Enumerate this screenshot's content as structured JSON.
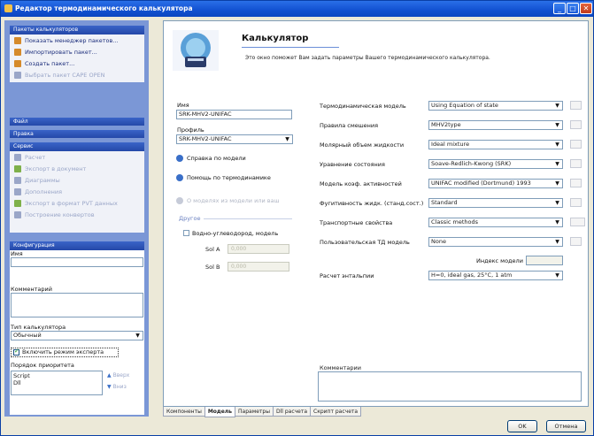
{
  "window": {
    "title": "Редактор термодинамического калькулятора"
  },
  "left": {
    "packages": {
      "header": "Пакеты калькуляторов",
      "items": [
        {
          "label": "Показать менеджер пакетов...",
          "icon": "package-manager-icon",
          "enabled": true
        },
        {
          "label": "Импортировать пакет...",
          "icon": "import-package-icon",
          "enabled": true
        },
        {
          "label": "Создать пакет...",
          "icon": "create-package-icon",
          "enabled": true
        },
        {
          "label": "Выбрать пакет CAPE OPEN",
          "icon": "cape-open-icon",
          "enabled": false
        }
      ]
    },
    "file_bar": "Файл",
    "edit_bar": "Правка",
    "service": {
      "header": "Сервис",
      "items": [
        {
          "label": "Расчет",
          "icon": "calculate-icon"
        },
        {
          "label": "Экспорт в документ",
          "icon": "export-document-icon"
        },
        {
          "label": "Диаграммы",
          "icon": "diagrams-icon"
        },
        {
          "label": "Дополнения",
          "icon": "addons-icon"
        },
        {
          "label": "Экспорт в формат PVT данных",
          "icon": "export-pvt-icon"
        },
        {
          "label": "Построение конвертов",
          "icon": "envelope-icon"
        }
      ]
    },
    "config": {
      "header": "Конфигурация",
      "name_label": "Имя",
      "name_value": "",
      "comment_label": "Комментарий",
      "comment_value": "",
      "calc_type_label": "Тип калькулятора",
      "calc_type_value": "Обычный",
      "expert_mode_label": "Включить режим эксперта",
      "priority_label": "Порядок приоритета",
      "priority_items": [
        "Script",
        "Dll"
      ],
      "up_label": "Вверх",
      "down_label": "Вниз"
    }
  },
  "main": {
    "title": "Калькулятор",
    "description": "Это окно поможет Вам задать параметры Вашего термодинамического калькулятора.",
    "name_label": "Имя",
    "name_value": "SRK-MHV2-UNIFAC",
    "profile_label": "Профиль",
    "profile_value": "SRK-MHV2-UNIFAC",
    "help_model": "Справка по модели",
    "help_thermo": "Помощь по термодинамике",
    "based_on_link": "О моделях из модели или ваш",
    "other_label": "Другое",
    "water_hc_label": "Водно-углеводород, модель",
    "sol_a_label": "Sol A",
    "sol_a_value": "0,000",
    "sol_b_label": "Sol B",
    "sol_b_value": "0,000",
    "properties": [
      {
        "label": "Термодинамическая модель",
        "value": "Using Equation of state"
      },
      {
        "label": "Правила смешения",
        "value": "MHV2type"
      },
      {
        "label": "Молярный объем жидкости",
        "value": "Ideal mixture"
      },
      {
        "label": "Уравнение состояния",
        "value": "Soave-Redlich-Kwong (SRK)"
      },
      {
        "label": "Модель коэф. активностей",
        "value": "UNIFAC modified (Dortmund) 1993"
      },
      {
        "label": "Фугитивность жидк. (станд.сост.)",
        "value": "Standard"
      },
      {
        "label": "Транспортные свойства",
        "value": "Classic methods"
      },
      {
        "label": "Пользовательская ТД модель",
        "value": "None"
      }
    ],
    "model_index_label": "Индекс модели",
    "model_index_value": "",
    "enthalpy_label": "Расчет энтальпии",
    "enthalpy_value": "H=0, ideal gas, 25°C, 1 atm",
    "comments_label": "Комментарии"
  },
  "tabs": [
    "Компоненты",
    "Модель",
    "Параметры",
    "Dll расчета",
    "Скрипт расчета"
  ],
  "active_tab": 1,
  "buttons": {
    "ok": "OK",
    "cancel": "Отмена"
  },
  "colors": {
    "title_bar": "#1150d0",
    "pane_bg": "#7b97d6",
    "accent": "#3a6fc8"
  }
}
